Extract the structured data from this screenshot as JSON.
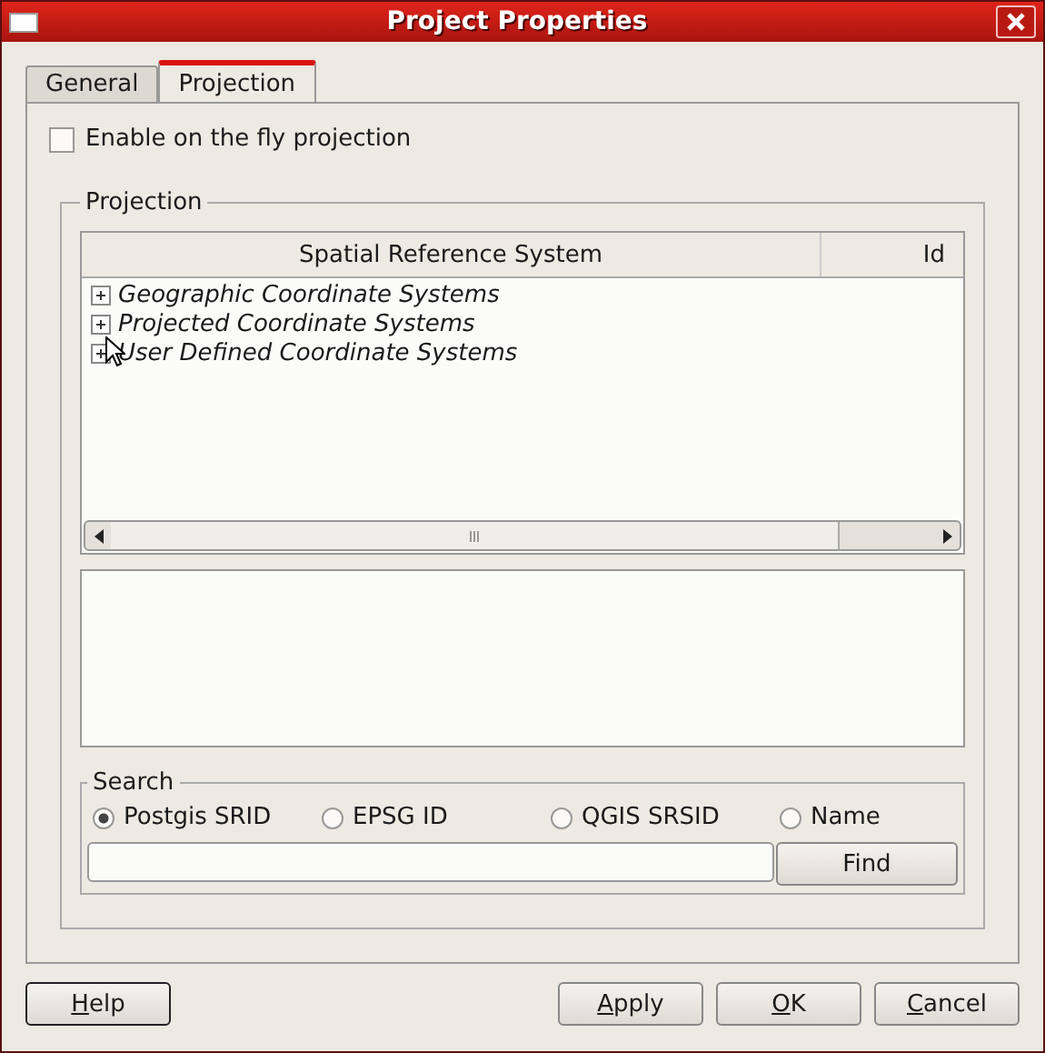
{
  "window": {
    "title": "Project Properties"
  },
  "tabs": [
    {
      "label": "General",
      "selected": false
    },
    {
      "label": "Projection",
      "selected": true
    }
  ],
  "on_the_fly": {
    "label": "Enable on the fly projection",
    "checked": false
  },
  "projection_group": {
    "title": "Projection",
    "tree": {
      "columns": [
        "Spatial Reference System",
        "Id"
      ],
      "items": [
        {
          "label": "Geographic Coordinate Systems",
          "expanded": false
        },
        {
          "label": "Projected Coordinate Systems",
          "expanded": false
        },
        {
          "label": "User Defined Coordinate Systems",
          "expanded": false
        }
      ]
    },
    "search": {
      "title": "Search",
      "options": [
        {
          "label": "Postgis SRID",
          "selected": true
        },
        {
          "label": "EPSG ID",
          "selected": false
        },
        {
          "label": "QGIS SRSID",
          "selected": false
        },
        {
          "label": "Name",
          "selected": false
        }
      ],
      "find_button": "Find"
    }
  },
  "buttons": {
    "left": [
      "Help"
    ],
    "right": [
      "Apply",
      "OK",
      "Cancel"
    ]
  }
}
